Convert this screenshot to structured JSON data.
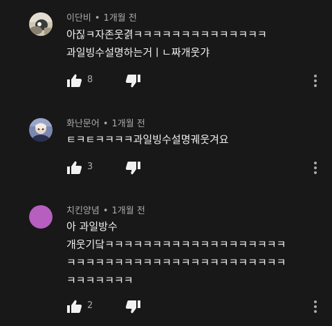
{
  "comments": [
    {
      "author": "이단비",
      "separator": "•",
      "time": "1개월 전",
      "lines": [
        "아짆ㅋ자존웃겱ㅋㅋㅋㅋㅋㅋㅋㅋㅋㅋㅋㅋㅋㅋ",
        "과일빙수설명하는거ㅣㄴ짜개웃갸"
      ],
      "likes": "8",
      "avatar_icon": "profile-photo-icon",
      "avatar_color": "#c8c0a8"
    },
    {
      "author": "화난문어",
      "separator": "•",
      "time": "1개월 전",
      "lines": [
        "ㅌㅋㅌㅋㅋㅋㅋ과일빙수설명궤웃겨요"
      ],
      "likes": "3",
      "avatar_icon": "profile-photo-icon",
      "avatar_color": "#6a7aa8"
    },
    {
      "author": "치킨양념",
      "separator": "•",
      "time": "1개월 전",
      "lines": [
        "아 과일방수",
        "개웃기닼ㅋㅋㅋㅋㅋㅋㅋㅋㅋㅋㅋㅋㅋㅋㅋㅋㅋㅋㅋ",
        "ㅋㅋㅋㅋㅋㅋㅋㅋㅋㅋㅋㅋㅋㅋㅋㅋㅋㅋㅋㅋㅋㅋㅋ",
        "ㅋㅋㅋㅋㅋㅋㅋ"
      ],
      "likes": "2",
      "avatar_icon": "default-avatar-icon",
      "avatar_color": "#b65fbe"
    }
  ],
  "icons": {
    "like": "thumbs-up-icon",
    "dislike": "thumbs-down-icon",
    "more": "more-vertical-icon"
  },
  "colors": {
    "background": "#181818",
    "text": "#f1f1f1",
    "secondary": "#aaaaaa"
  }
}
